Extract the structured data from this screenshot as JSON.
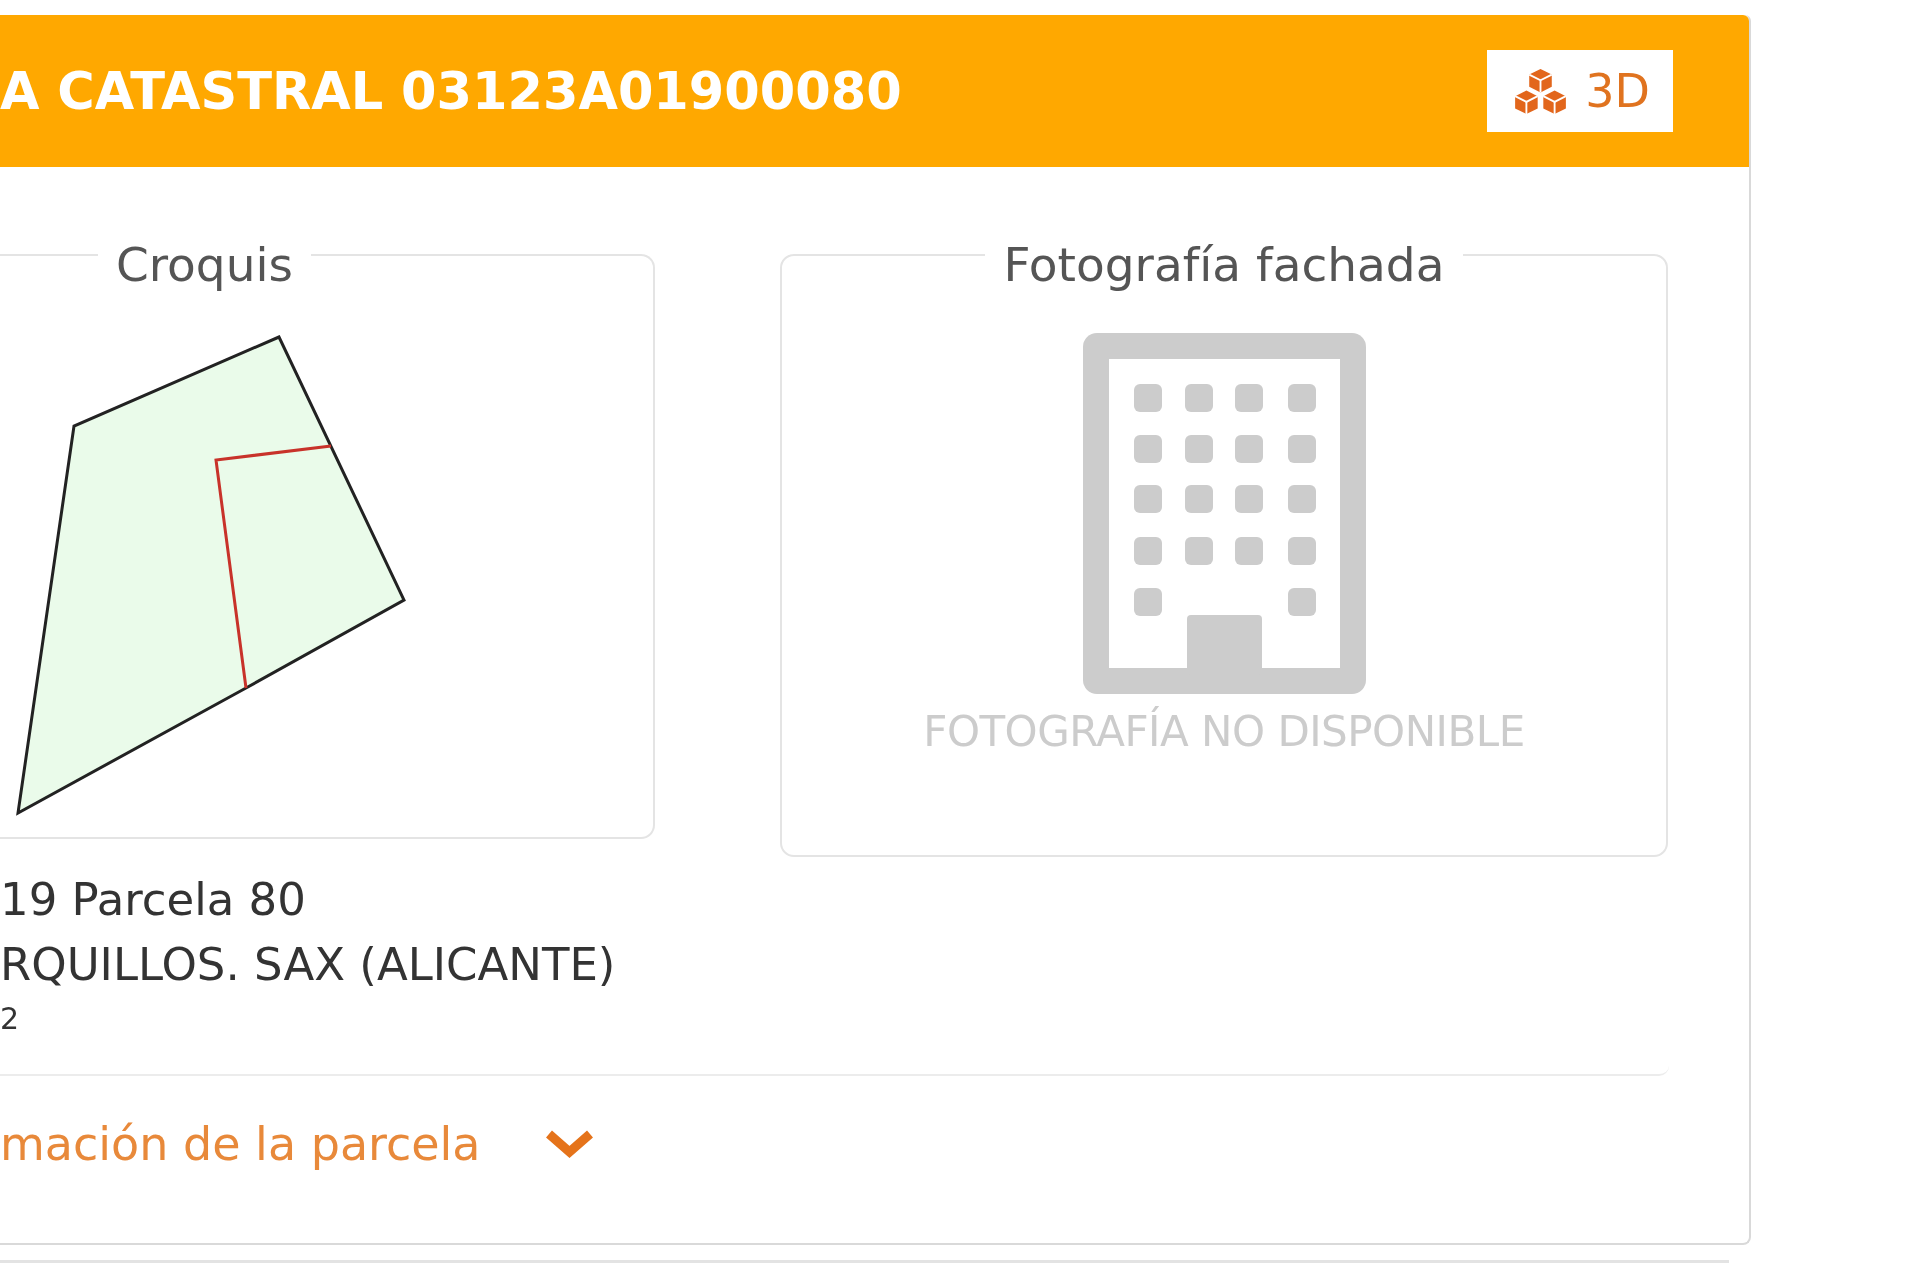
{
  "header": {
    "title": "A CATASTRAL 03123A01900080",
    "button": {
      "label": "3D"
    }
  },
  "sketch": {
    "legend": "Croquis"
  },
  "facade_photo": {
    "legend": "Fotografía fachada",
    "message": "FOTOGRAFÍA NO DISPONIBLE"
  },
  "details": [
    {
      "text": "19 Parcela 80",
      "kind": "line"
    },
    {
      "text": "RQUILLOS. SAX (ALICANTE)",
      "kind": "line"
    },
    {
      "text": "2",
      "kind": "small"
    }
  ],
  "more_info": {
    "label": "mación de la parcela",
    "expanded": false
  }
}
